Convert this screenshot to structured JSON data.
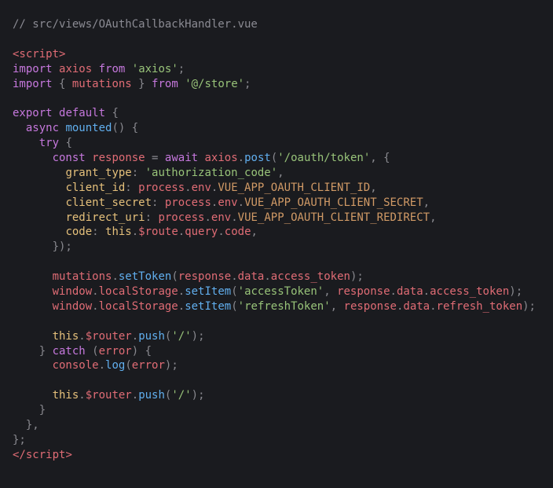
{
  "code": {
    "l1": {
      "comment": "// src/views/OAuthCallbackHandler.vue"
    },
    "l3": {
      "open_tag": "<script>"
    },
    "l4": {
      "kw1": "import",
      "id1": "axios",
      "kw2": "from",
      "str": "'axios'",
      "p": ";"
    },
    "l5": {
      "kw1": "import",
      "p1": " { ",
      "id1": "mutations",
      "p2": " } ",
      "kw2": "from",
      "str": "'@/store'",
      "p3": ";"
    },
    "l7": {
      "kw1": "export",
      "kw2": "default",
      "p": " {"
    },
    "l8": {
      "kw": "async",
      "fn": "mounted",
      "p": "() {"
    },
    "l9": {
      "kw": "try",
      "p": " {"
    },
    "l10_a": {
      "kw": "const",
      "id": "response",
      "op": " = ",
      "kw2": "await",
      "id2": "axios",
      "dot": ".",
      "fn": "post",
      "p1": "(",
      "str": "'/oauth/token'",
      "p2": ", {"
    },
    "l11": {
      "prop": "grant_type",
      "p1": ": ",
      "str": "'authorization_code'",
      "p2": ","
    },
    "l12": {
      "prop": "client_id",
      "p1": ": ",
      "id1": "process",
      "d1": ".",
      "id2": "env",
      "d2": ".",
      "id3": "VUE_APP_OAUTH_CLIENT_ID",
      "p2": ","
    },
    "l13": {
      "prop": "client_secret",
      "p1": ": ",
      "id1": "process",
      "d1": ".",
      "id2": "env",
      "d2": ".",
      "id3": "VUE_APP_OAUTH_CLIENT_SECRET",
      "p2": ","
    },
    "l14": {
      "prop": "redirect_uri",
      "p1": ": ",
      "id1": "process",
      "d1": ".",
      "id2": "env",
      "d2": ".",
      "id3": "VUE_APP_OAUTH_CLIENT_REDIRECT",
      "p2": ","
    },
    "l15": {
      "prop": "code",
      "p1": ": ",
      "this": "this",
      "d1": ".",
      "id1": "$route",
      "d2": ".",
      "id2": "query",
      "d3": ".",
      "id3": "code",
      "p2": ","
    },
    "l16": {
      "p": "});"
    },
    "l18": {
      "id1": "mutations",
      "d1": ".",
      "fn": "setToken",
      "p1": "(",
      "id2": "response",
      "d2": ".",
      "id3": "data",
      "d3": ".",
      "id4": "access_token",
      "p2": ");"
    },
    "l19": {
      "id1": "window",
      "d1": ".",
      "id2": "localStorage",
      "d2": ".",
      "fn": "setItem",
      "p1": "(",
      "str": "'accessToken'",
      "p2": ", ",
      "id3": "response",
      "d3": ".",
      "id4": "data",
      "d4": ".",
      "id5": "access_token",
      "p3": ");"
    },
    "l20": {
      "id1": "window",
      "d1": ".",
      "id2": "localStorage",
      "d2": ".",
      "fn": "setItem",
      "p1": "(",
      "str": "'refreshToken'",
      "p2": ", ",
      "id3": "response",
      "d3": ".",
      "id4": "data",
      "d4": ".",
      "id5": "refresh_token",
      "p3": ");"
    },
    "l22": {
      "this": "this",
      "d1": ".",
      "id1": "$router",
      "d2": ".",
      "fn": "push",
      "p1": "(",
      "str": "'/'",
      "p2": ");"
    },
    "l23": {
      "p1": "} ",
      "kw": "catch",
      "p2": " (",
      "id": "error",
      "p3": ") {"
    },
    "l24": {
      "id1": "console",
      "d1": ".",
      "fn": "log",
      "p1": "(",
      "id2": "error",
      "p2": ");"
    },
    "l26": {
      "this": "this",
      "d1": ".",
      "id1": "$router",
      "d2": ".",
      "fn": "push",
      "p1": "(",
      "str": "'/'",
      "p2": ");"
    },
    "l27": {
      "p": "}"
    },
    "l28": {
      "p": "},"
    },
    "l29": {
      "p": "};"
    },
    "l30": {
      "close_tag_open": "</",
      "close_tag_name": "script",
      "close_tag_close": ">"
    }
  }
}
